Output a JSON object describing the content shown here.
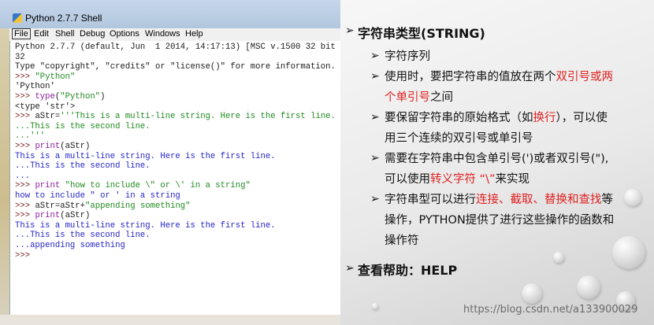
{
  "window": {
    "title": "Python 2.7.7 Shell",
    "icon": "python-icon",
    "menu": [
      "File",
      "Edit",
      "Shell",
      "Debug",
      "Options",
      "Windows",
      "Help"
    ]
  },
  "shell_lines": [
    {
      "segments": [
        {
          "t": "Python 2.7.7 (default, Jun  1 2014, 14:17:13) [MSC v.1500 32 bit (",
          "c": "out"
        }
      ]
    },
    {
      "segments": [
        {
          "t": "32",
          "c": "out"
        }
      ]
    },
    {
      "segments": [
        {
          "t": "Type \"copyright\", \"credits\" or \"license()\" for more information.",
          "c": "out"
        }
      ]
    },
    {
      "segments": [
        {
          "t": ">>> ",
          "c": "prompt"
        },
        {
          "t": "\"Python\"",
          "c": "str"
        }
      ]
    },
    {
      "segments": [
        {
          "t": "'Python'",
          "c": "res"
        }
      ]
    },
    {
      "segments": [
        {
          "t": ">>> ",
          "c": "prompt"
        },
        {
          "t": "type",
          "c": "kw"
        },
        {
          "t": "(",
          "c": "res"
        },
        {
          "t": "\"Python\"",
          "c": "str"
        },
        {
          "t": ")",
          "c": "res"
        }
      ]
    },
    {
      "segments": [
        {
          "t": "<type 'str'>",
          "c": "res"
        }
      ]
    },
    {
      "segments": [
        {
          "t": ">>> ",
          "c": "prompt"
        },
        {
          "t": "aStr=",
          "c": "res"
        },
        {
          "t": "'''This is a multi-line string. Here is the first line.",
          "c": "str"
        }
      ]
    },
    {
      "segments": [
        {
          "t": "...This is the second line.",
          "c": "str"
        }
      ]
    },
    {
      "segments": [
        {
          "t": "...'''",
          "c": "str"
        }
      ]
    },
    {
      "segments": [
        {
          "t": ">>> ",
          "c": "prompt"
        },
        {
          "t": "print",
          "c": "kw"
        },
        {
          "t": "(aStr)",
          "c": "res"
        }
      ]
    },
    {
      "segments": [
        {
          "t": "This is a multi-line string. Here is the first line.",
          "c": "stdout"
        }
      ]
    },
    {
      "segments": [
        {
          "t": "...This is the second line.",
          "c": "stdout"
        }
      ]
    },
    {
      "segments": [
        {
          "t": "...",
          "c": "stdout"
        }
      ]
    },
    {
      "segments": [
        {
          "t": ">>> ",
          "c": "prompt"
        },
        {
          "t": "print",
          "c": "kw"
        },
        {
          "t": " ",
          "c": "res"
        },
        {
          "t": "\"how to include \\\" or \\' in a string\"",
          "c": "str"
        }
      ]
    },
    {
      "segments": [
        {
          "t": "how to include \" or ' in a string",
          "c": "stdout"
        }
      ]
    },
    {
      "segments": [
        {
          "t": ">>> ",
          "c": "prompt"
        },
        {
          "t": "aStr=aStr+",
          "c": "res"
        },
        {
          "t": "\"appending something\"",
          "c": "str"
        }
      ]
    },
    {
      "segments": [
        {
          "t": ">>> ",
          "c": "prompt"
        },
        {
          "t": "print",
          "c": "kw"
        },
        {
          "t": "(aStr)",
          "c": "res"
        }
      ]
    },
    {
      "segments": [
        {
          "t": "This is a multi-line string. Here is the first line.",
          "c": "stdout"
        }
      ]
    },
    {
      "segments": [
        {
          "t": "...This is the second line.",
          "c": "stdout"
        }
      ]
    },
    {
      "segments": [
        {
          "t": "...appending something",
          "c": "stdout"
        }
      ]
    },
    {
      "segments": [
        {
          "t": ">>> ",
          "c": "prompt"
        }
      ]
    }
  ],
  "slide": {
    "h1": "字符串类型(STRING)",
    "items": [
      {
        "lines": [
          [
            {
              "t": "字符序列"
            }
          ]
        ]
      },
      {
        "lines": [
          [
            {
              "t": "使用时，要把字符串的值放在两个"
            },
            {
              "t": "双引号或两",
              "red": true
            }
          ],
          [
            {
              "t": "个单引号",
              "red": true
            },
            {
              "t": "之间"
            }
          ]
        ]
      },
      {
        "lines": [
          [
            {
              "t": "要保留字符串的原始格式（如"
            },
            {
              "t": "换行",
              "red": true
            },
            {
              "t": "），可以使"
            }
          ],
          [
            {
              "t": "用三个连续的双引号或单引号"
            }
          ]
        ]
      },
      {
        "lines": [
          [
            {
              "t": "需要在字符串中包含单引号(')或者双引号(\"),"
            }
          ],
          [
            {
              "t": "可以使用"
            },
            {
              "t": "转义字符 “\\”",
              "red": true
            },
            {
              "t": "来实现"
            }
          ]
        ]
      },
      {
        "lines": [
          [
            {
              "t": "字符串型可以进行"
            },
            {
              "t": "连接、截取、替换和查找",
              "red": true
            },
            {
              "t": "等"
            }
          ],
          [
            {
              "t": "操作，PYTHON提供了进行这些操作的函数和"
            }
          ],
          [
            {
              "t": "操作符"
            }
          ]
        ]
      }
    ],
    "h2": "查看帮助：HELP",
    "watermark": "https://blog.csdn.net/a133900029"
  },
  "colors": {
    "red": "#e02020",
    "prompt": "#7a1818",
    "string": "#1f8a1f",
    "keyword": "#8d1d9e",
    "stdout": "#2525c8"
  }
}
